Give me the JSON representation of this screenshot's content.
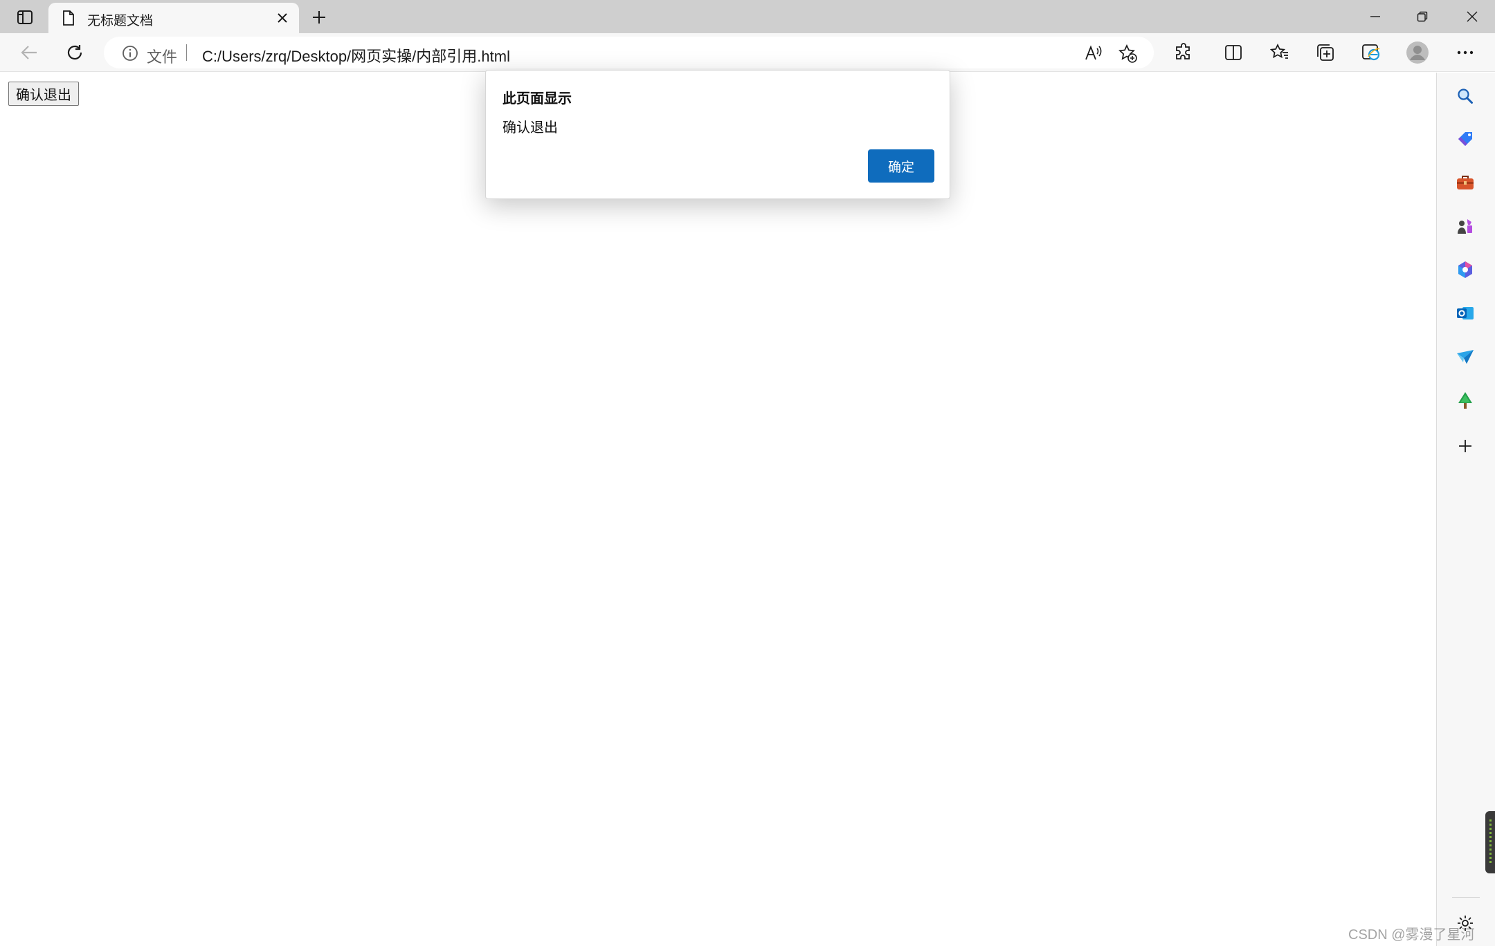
{
  "tab": {
    "title": "无标题文档"
  },
  "address_bar": {
    "scheme_label": "文件",
    "url": "C:/Users/zrq/Desktop/网页实操/内部引用.html"
  },
  "page": {
    "button_label": "确认退出"
  },
  "dialog": {
    "title": "此页面显示",
    "message": "确认退出",
    "ok_label": "确定"
  },
  "toolbar_icons": [
    "back-arrow-icon",
    "refresh-icon",
    "read-aloud-icon",
    "add-favorite-icon",
    "extensions-icon",
    "split-screen-icon",
    "favorites-icon",
    "collections-icon",
    "ie-mode-icon",
    "profile-avatar-icon",
    "more-menu-icon"
  ],
  "sidebar_icons": [
    "search-icon",
    "shopping-tag-icon",
    "tools-briefcase-icon",
    "games-icon",
    "microsoft-365-icon",
    "outlook-icon",
    "send-icon",
    "tree-icon",
    "add-icon",
    "settings-icon"
  ],
  "watermark": "CSDN @雾漫了星河",
  "colors": {
    "accent": "#0f6cbd",
    "titlebar": "#cfcfcf",
    "toolbar": "#f7f7f7"
  }
}
